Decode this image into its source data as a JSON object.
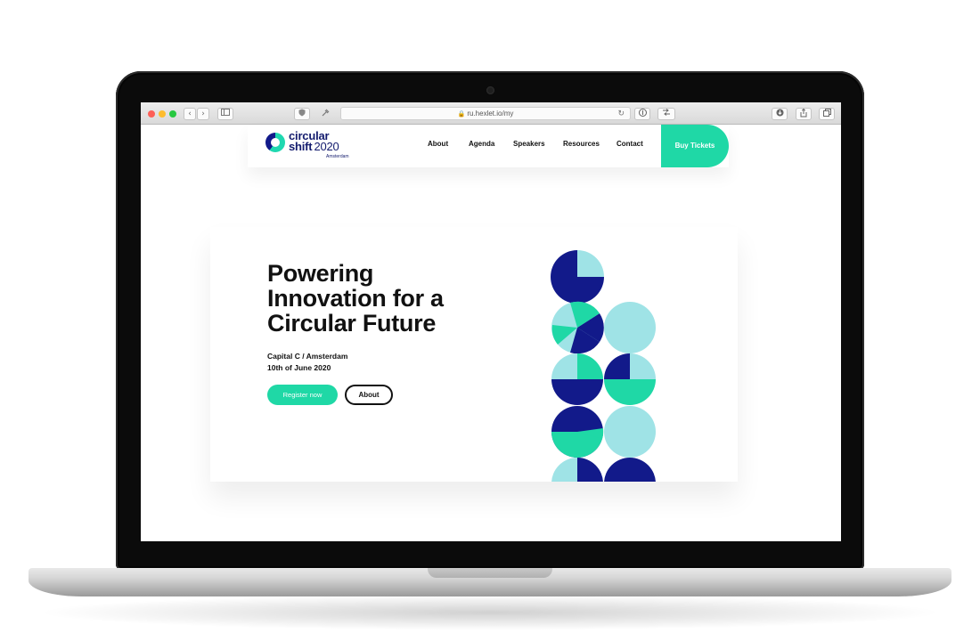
{
  "browser": {
    "url": "ru.hexlet.io/my",
    "nav_back": "‹",
    "nav_forward": "›"
  },
  "site": {
    "logo": {
      "line1": "circular",
      "line2": "shift",
      "year": "2020",
      "city": "Amsterdam"
    },
    "nav": [
      "About",
      "Agenda",
      "Speakers",
      "Resources",
      "Contact"
    ],
    "cta": "Buy Tickets"
  },
  "hero": {
    "title_lines": [
      "Powering",
      "Innovation for a",
      "Circular Future"
    ],
    "venue": "Capital C / Amsterdam",
    "date": "10th of June 2020",
    "register_label": "Register now",
    "about_label": "About"
  },
  "colors": {
    "accent": "#1fd8a6",
    "navy": "#121a8a",
    "light": "#9fe3e6"
  }
}
